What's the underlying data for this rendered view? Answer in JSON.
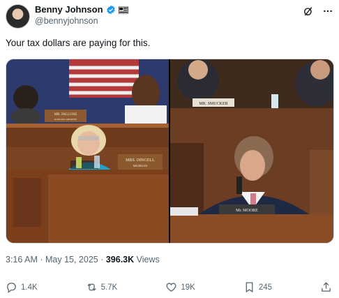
{
  "author": {
    "display_name": "Benny Johnson",
    "handle": "@bennyjohnson"
  },
  "tweet": {
    "text": "Your tax dollars are paying for this."
  },
  "media": {
    "left_nameplates": {
      "top": "MR. PALLONE",
      "top_sub": "RANKING MEMBER",
      "main": "MRS. DINGELL",
      "main_sub": "MICHIGAN"
    },
    "right_nameplates": {
      "top": "MR. SMUCKER",
      "main": "Mr. MOORE"
    }
  },
  "meta": {
    "time": "3:16 AM",
    "separator": " · ",
    "date": "May 15, 2025",
    "views_count": "396.3K",
    "views_label": " Views"
  },
  "actions": {
    "replies": "1.4K",
    "reposts": "5.7K",
    "likes": "19K",
    "bookmarks": "245"
  },
  "icons": [
    "verified-badge-icon",
    "affiliate-flag-icon",
    "grok-icon",
    "more-icon",
    "reply-icon",
    "repost-icon",
    "like-icon",
    "bookmark-icon",
    "share-icon"
  ],
  "colors": {
    "verified": "#1d9bf0",
    "secondary_text": "#536471"
  }
}
